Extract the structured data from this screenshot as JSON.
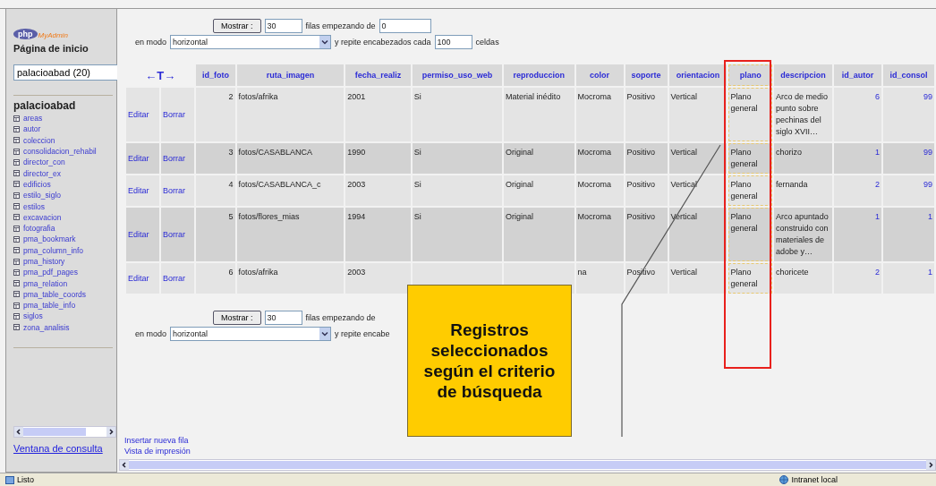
{
  "sidebar": {
    "logo": {
      "php": "php",
      "name": "MyAdmin"
    },
    "home_link": "Página de inicio",
    "database_select": {
      "value": "palacioabad (20)"
    },
    "database": "palacioabad",
    "tables": [
      "areas",
      "autor",
      "coleccion",
      "consolidacion_rehabil",
      "director_con",
      "director_ex",
      "edificios",
      "estilo_siglo",
      "estilos",
      "excavacion",
      "fotografia",
      "pma_bookmark",
      "pma_column_info",
      "pma_history",
      "pma_pdf_pages",
      "pma_relation",
      "pma_table_coords",
      "pma_table_info",
      "siglos",
      "zona_analisis"
    ],
    "query_window_link": "Ventana de consulta"
  },
  "top_controls": {
    "show_button": "Mostrar :",
    "rows_value": "30",
    "rows_label": "filas empezando de",
    "start_value": "0",
    "mode_label": "en modo",
    "mode_value": "horizontal",
    "repeat_label": "y repite encabezados cada",
    "repeat_value": "100",
    "cells_label": "celdas"
  },
  "table": {
    "arrows": "←T→",
    "columns": [
      {
        "label": "id_foto",
        "kind": "number",
        "highlighted": false
      },
      {
        "label": "ruta_imagen",
        "kind": "text",
        "highlighted": false
      },
      {
        "label": "fecha_realiz",
        "kind": "text",
        "highlighted": false
      },
      {
        "label": "permiso_uso_web",
        "kind": "text",
        "highlighted": false
      },
      {
        "label": "reproduccion",
        "kind": "text",
        "highlighted": false
      },
      {
        "label": "color",
        "kind": "text",
        "highlighted": false
      },
      {
        "label": "soporte",
        "kind": "text",
        "highlighted": false
      },
      {
        "label": "orientacion",
        "kind": "text",
        "highlighted": false
      },
      {
        "label": "plano",
        "kind": "text",
        "highlighted": true
      },
      {
        "label": "descripcion",
        "kind": "text",
        "highlighted": false
      },
      {
        "label": "id_autor",
        "kind": "link",
        "highlighted": false
      },
      {
        "label": "id_consol",
        "kind": "link",
        "highlighted": false
      }
    ],
    "rows": [
      {
        "edit": "Editar",
        "delete": "Borrar",
        "cells": [
          "2",
          "fotos/afrika",
          "2001",
          "Si",
          "Material inédito",
          "Mocroma",
          "Positivo",
          "Vertical",
          "Plano general",
          "Arco de medio punto sobre pechinas del siglo XVII…",
          "6",
          "99"
        ]
      },
      {
        "edit": "Editar",
        "delete": "Borrar",
        "cells": [
          "3",
          "fotos/CASABLANCA",
          "1990",
          "Si",
          "Original",
          "Mocroma",
          "Positivo",
          "Vertical",
          "Plano general",
          "chorizo",
          "1",
          "99"
        ]
      },
      {
        "edit": "Editar",
        "delete": "Borrar",
        "cells": [
          "4",
          "fotos/CASABLANCA_c",
          "2003",
          "Si",
          "Original",
          "Mocroma",
          "Positivo",
          "Vertical",
          "Plano general",
          "fernanda",
          "2",
          "99"
        ]
      },
      {
        "edit": "Editar",
        "delete": "Borrar",
        "cells": [
          "5",
          "fotos/flores_mias",
          "1994",
          "Si",
          "Original",
          "Mocroma",
          "Positivo",
          "Vertical",
          "Plano general",
          "Arco apuntado construido con materiales de adobe y…",
          "1",
          "1"
        ]
      },
      {
        "edit": "Editar",
        "delete": "Borrar",
        "cells": [
          "6",
          "fotos/afrika",
          "2003",
          "",
          "",
          "na",
          "Positivo",
          "Vertical",
          "Plano general",
          "choricete",
          "2",
          "1"
        ]
      }
    ]
  },
  "bottom_controls": {
    "show_button": "Mostrar :",
    "rows_value": "30",
    "rows_label": "filas empezando de",
    "mode_label": "en modo",
    "mode_value": "horizontal",
    "repeat_label": "y repite encabe"
  },
  "links": [
    "Insertar nueva fila",
    "Vista de impresión"
  ],
  "callout": "Registros seleccionados según el criterio de búsqueda",
  "status_bar": {
    "status": "Listo",
    "zone": "Intranet local"
  }
}
